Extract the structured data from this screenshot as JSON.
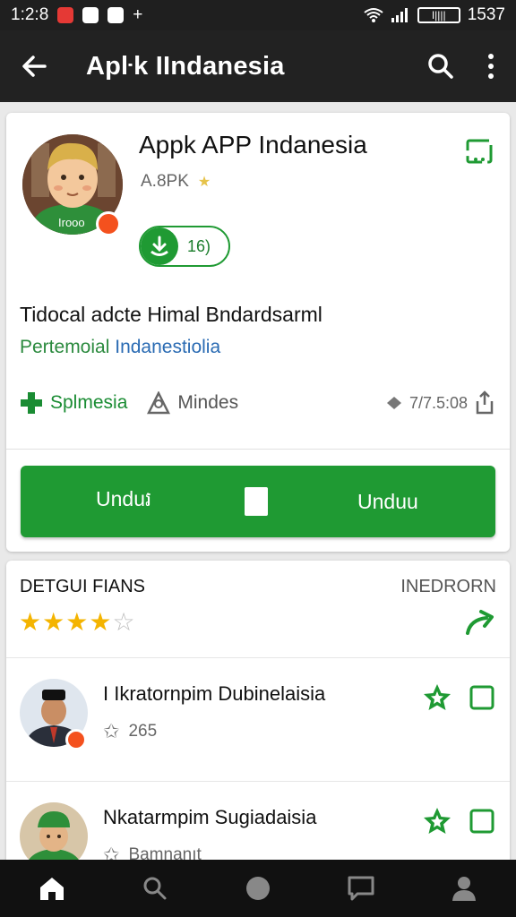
{
  "status_bar": {
    "time_left": "1:2:8",
    "time_right": "1537",
    "battery_text": "I||||"
  },
  "app_bar": {
    "title": "Apŀk IIndanesia"
  },
  "app": {
    "name": "Appk APP Indanesia",
    "developer": "A.8PK",
    "icon_label": "Irooo",
    "downloads_badge": "16)",
    "description": "Tidocal adcte Himal Bndardsarml",
    "tagline_green": "Pertemoial",
    "tagline_blue": "Indanestiolia",
    "category": "Splmesia",
    "publisher": "Mindes",
    "size": "7/7.5:08",
    "download_left": "Unduរ",
    "download_right": "Unduu"
  },
  "reviews": {
    "heading": "DETGUI FIANS",
    "more": "INEDRORN",
    "stars_filled": 4,
    "stars_total": 5,
    "items": [
      {
        "name": "I Ikratornpim Dubinelaisia",
        "sub": "265"
      },
      {
        "name": "Nkatarmpim Sugiadaisia",
        "sub": "Bamnanıt"
      }
    ]
  },
  "colors": {
    "accent": "#1f9a33",
    "appbar": "#222222",
    "badge": "#f4511e"
  },
  "icons": [
    "back-arrow-icon",
    "search-icon",
    "overflow-menu-icon",
    "bookmark-icon",
    "download-icon",
    "category-icon",
    "publisher-icon",
    "size-icon",
    "share-icon",
    "star-icon",
    "home-icon",
    "nav-search-icon",
    "circle-icon",
    "chat-icon",
    "profile-icon"
  ]
}
